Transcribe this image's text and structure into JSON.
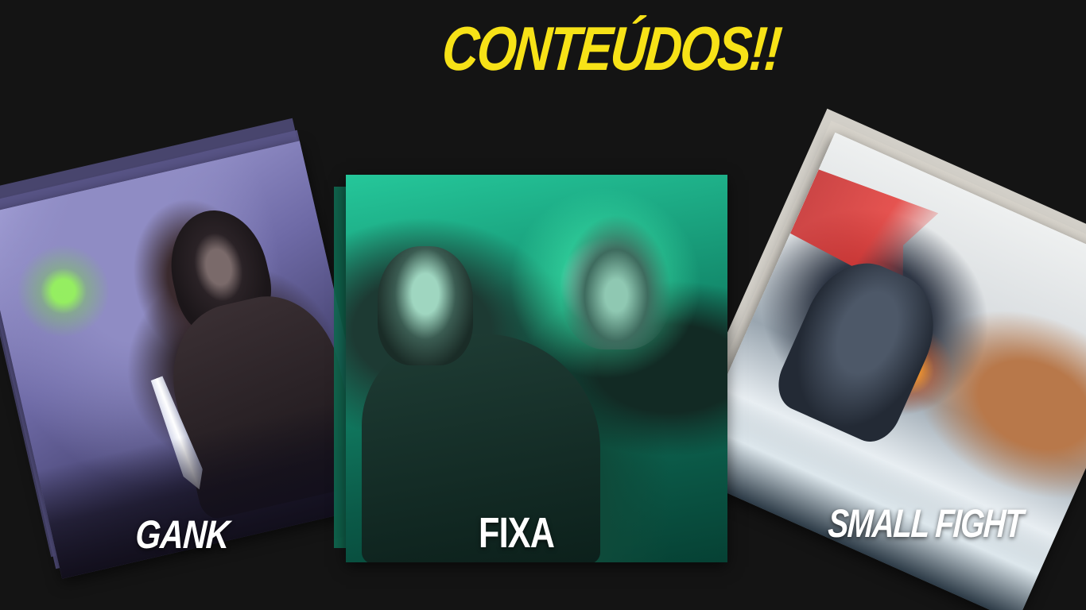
{
  "page": {
    "title": "CONTEÚDOS!!",
    "title_color": "#f7e217",
    "background_color": "#141414"
  },
  "cards": [
    {
      "label": "GANK",
      "theme": "night-rogue",
      "accent": "#6e6aa6"
    },
    {
      "label": "FIXA",
      "theme": "undead-green",
      "accent": "#138a6c"
    },
    {
      "label": "SMALL FIGHT",
      "theme": "battlefield",
      "accent": "#c62828"
    }
  ]
}
